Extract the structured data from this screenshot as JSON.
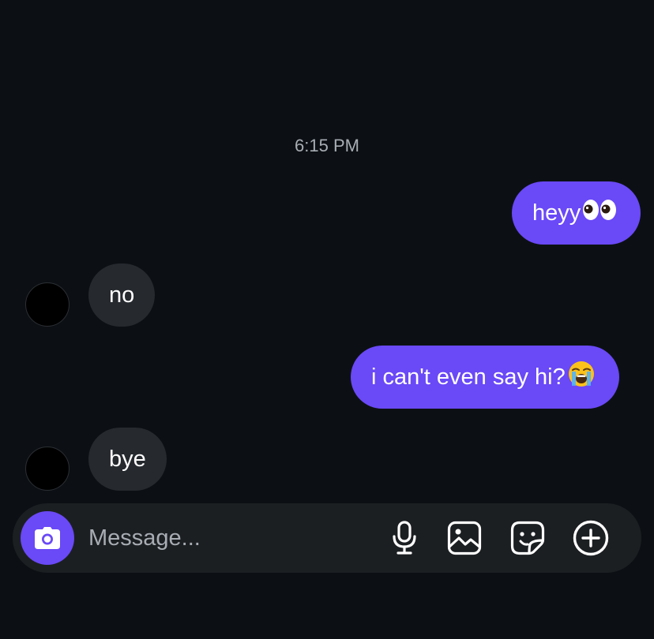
{
  "chat": {
    "timestamp": "6:15 PM",
    "messages": [
      {
        "direction": "outgoing",
        "text": "heyy",
        "emoji": "eyes"
      },
      {
        "direction": "incoming",
        "text": "no"
      },
      {
        "direction": "outgoing",
        "text": "i can't even say hi?",
        "emoji": "loudly-crying-face"
      },
      {
        "direction": "incoming",
        "text": "bye"
      }
    ]
  },
  "composer": {
    "placeholder": "Message...",
    "value": "",
    "icons": [
      "camera-icon",
      "microphone-icon",
      "gallery-icon",
      "sticker-icon",
      "add-circle-icon"
    ]
  },
  "colors": {
    "background": "#0c1014",
    "outgoing_bubble": "#6a49f7",
    "incoming_bubble": "#262a2f",
    "composer": "#1c1f22",
    "muted_text": "#a8adb4"
  }
}
